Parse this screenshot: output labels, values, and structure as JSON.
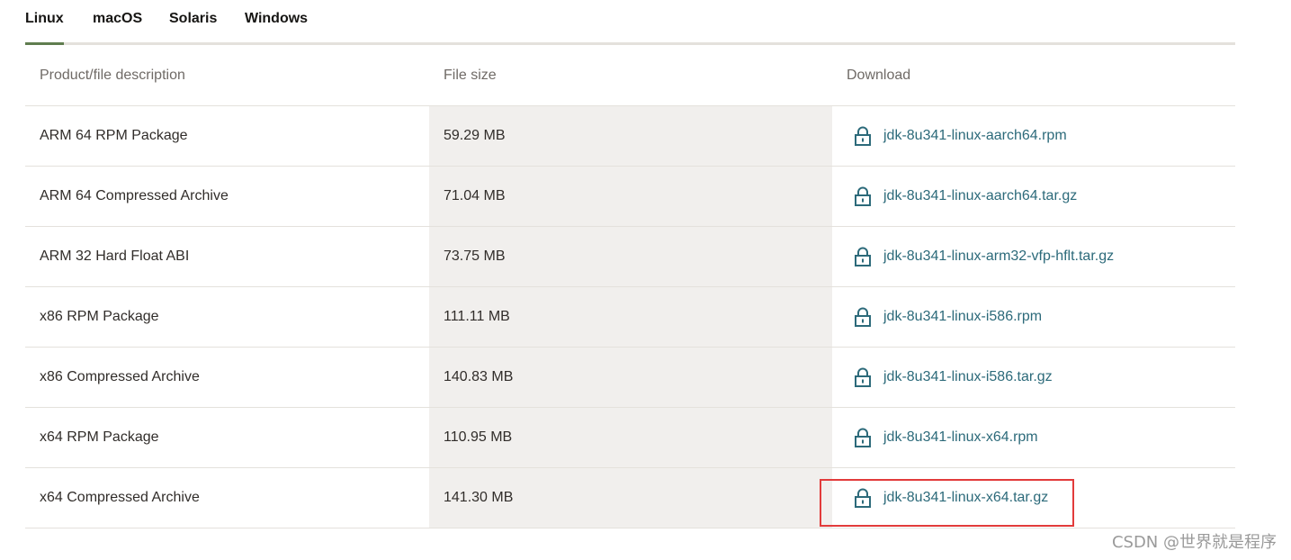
{
  "tabs": [
    {
      "label": "Linux",
      "active": true
    },
    {
      "label": "macOS",
      "active": false
    },
    {
      "label": "Solaris",
      "active": false
    },
    {
      "label": "Windows",
      "active": false
    }
  ],
  "table": {
    "headers": {
      "description": "Product/file description",
      "size": "File size",
      "download": "Download"
    },
    "rows": [
      {
        "description": "ARM 64 RPM Package",
        "size": "59.29 MB",
        "file": "jdk-8u341-linux-aarch64.rpm"
      },
      {
        "description": "ARM 64 Compressed Archive",
        "size": "71.04 MB",
        "file": "jdk-8u341-linux-aarch64.tar.gz"
      },
      {
        "description": "ARM 32 Hard Float ABI",
        "size": "73.75 MB",
        "file": "jdk-8u341-linux-arm32-vfp-hflt.tar.gz"
      },
      {
        "description": "x86 RPM Package",
        "size": "111.11 MB",
        "file": "jdk-8u341-linux-i586.rpm"
      },
      {
        "description": "x86 Compressed Archive",
        "size": "140.83 MB",
        "file": "jdk-8u341-linux-i586.tar.gz"
      },
      {
        "description": "x64 RPM Package",
        "size": "110.95 MB",
        "file": "jdk-8u341-linux-x64.rpm"
      },
      {
        "description": "x64 Compressed Archive",
        "size": "141.30 MB",
        "file": "jdk-8u341-linux-x64.tar.gz"
      }
    ]
  },
  "icons": {
    "download_lock": "lock-icon"
  },
  "colors": {
    "link": "#2c6a7a",
    "active_tab_underline": "#5f7d4f",
    "size_column_bg": "#f1efed",
    "highlight_box": "#e23b3b"
  },
  "watermark": "CSDN @世界就是程序"
}
